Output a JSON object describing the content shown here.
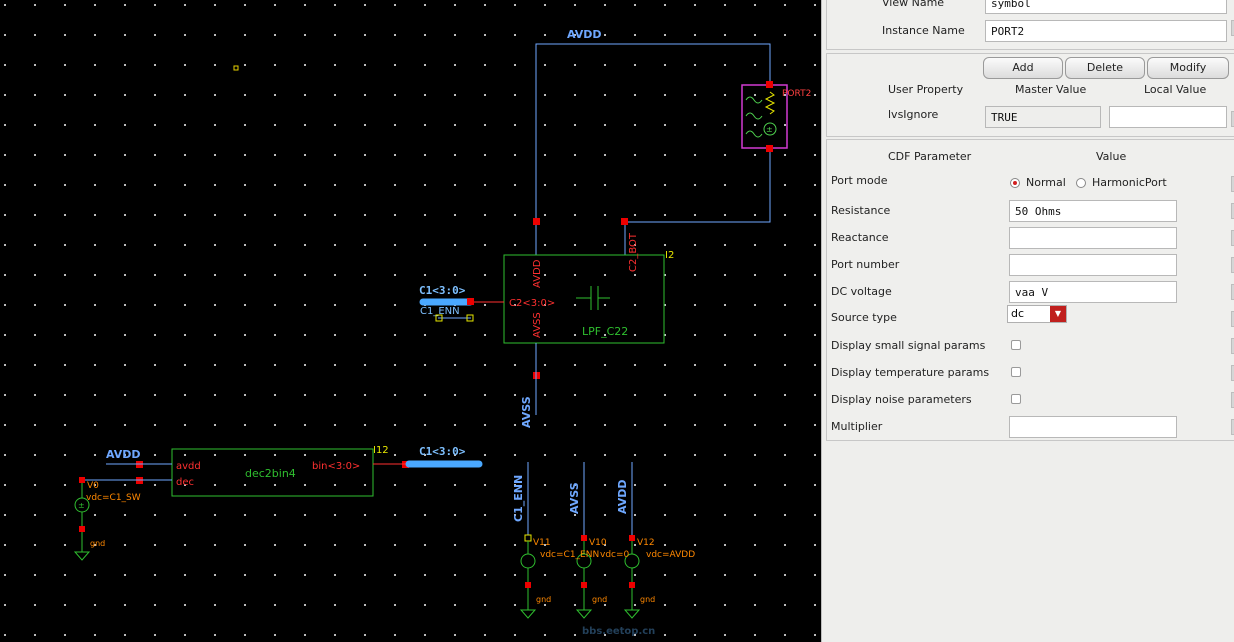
{
  "schematic": {
    "nets": {
      "avdd": "AVDD",
      "avss": "AVSS",
      "c1_bus": "C1<3:0>",
      "c1_enn": "C1_ENN"
    },
    "port_instance": "PORT2",
    "lpf": {
      "instance": "I2",
      "cell": "LPF_C22",
      "pin_avdd": "AVDD",
      "pin_avss": "AVSS",
      "pin_c2": "C2<3:0>",
      "pin_c2bot": "C2_BOT"
    },
    "dec": {
      "instance": "I12",
      "cell": "dec2bin4",
      "pin_avdd": "avdd",
      "pin_dec": "dec",
      "pin_bin": "bin<3:0>"
    },
    "sources": {
      "v0": {
        "name": "V0",
        "param": "vdc=C1_SW"
      },
      "v11": {
        "name": "V11",
        "param": "vdc=C1_ENN"
      },
      "v10": {
        "name": "V10",
        "param": "vdc=0"
      },
      "v12": {
        "name": "V12",
        "param": "vdc=AVDD"
      }
    },
    "gnd": "gnd",
    "watermark": "bbs.eetop.cn"
  },
  "panel": {
    "view_name_label": "View Name",
    "view_name_value": "symbol",
    "instance_name_label": "Instance Name",
    "instance_name_value": "PORT2",
    "buttons": {
      "add": "Add",
      "delete": "Delete",
      "modify": "Modify"
    },
    "user_prop": {
      "col_user": "User Property",
      "col_master": "Master Value",
      "col_local": "Local Value",
      "row_name": "lvsIgnore",
      "row_master": "TRUE",
      "row_local": ""
    },
    "cdf": {
      "col_param": "CDF Parameter",
      "col_value": "Value",
      "port_mode_label": "Port mode",
      "port_mode_options": [
        "Normal",
        "HarmonicPort"
      ],
      "port_mode_selected": "Normal",
      "resistance_label": "Resistance",
      "resistance_value": "50 Ohms",
      "reactance_label": "Reactance",
      "reactance_value": "",
      "port_number_label": "Port number",
      "port_number_value": "",
      "dc_voltage_label": "DC voltage",
      "dc_voltage_value": "vaa V",
      "source_type_label": "Source type",
      "source_type_value": "dc",
      "small_signal_label": "Display small signal params",
      "temperature_label": "Display temperature params",
      "noise_label": "Display noise parameters",
      "multiplier_label": "Multiplier",
      "multiplier_value": ""
    }
  }
}
